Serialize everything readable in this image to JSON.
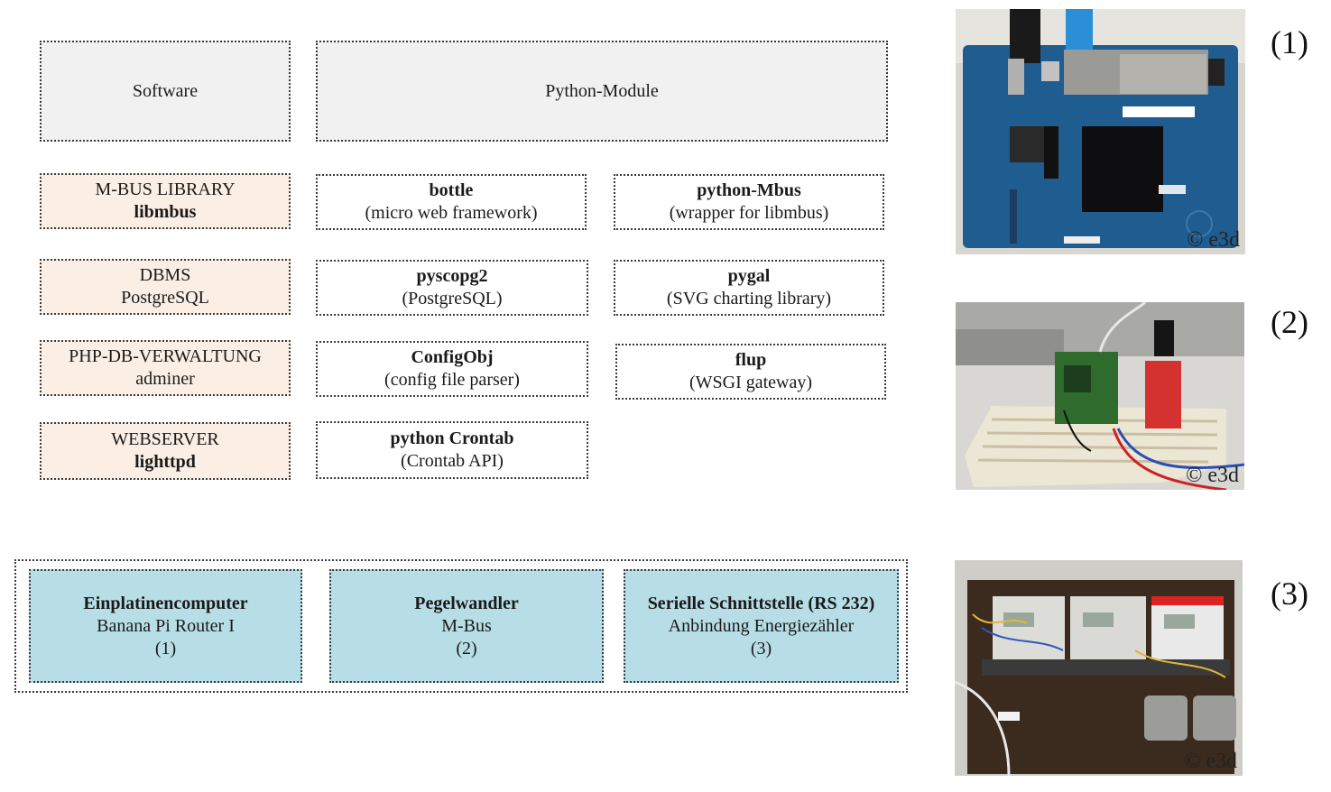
{
  "header": {
    "software": "Software",
    "python_modules": "Python-Module"
  },
  "software": [
    {
      "line1": "M-BUS LIBRARY",
      "line2": "libmbus"
    },
    {
      "line1": "DBMS",
      "line2": "PostgreSQL"
    },
    {
      "line1": "PHP-DB-VERWALTUNG",
      "line2": "adminer"
    },
    {
      "line1": "WEBSERVER",
      "line2": "lighttpd"
    }
  ],
  "modules": [
    {
      "name": "bottle",
      "desc": "(micro web framework)"
    },
    {
      "name": "python-Mbus",
      "desc": "(wrapper for libmbus)"
    },
    {
      "name": "pyscopg2",
      "desc": "(PostgreSQL)"
    },
    {
      "name": "pygal",
      "desc": "(SVG charting library)"
    },
    {
      "name": "ConfigObj",
      "desc": "(config file parser)"
    },
    {
      "name": "flup",
      "desc": "(WSGI gateway)"
    },
    {
      "name": "python Crontab",
      "desc": "(Crontab API)"
    }
  ],
  "hardware": [
    {
      "title": "Einplatinencomputer",
      "sub": "Banana Pi Router I",
      "ref": "(1)"
    },
    {
      "title": "Pegelwandler",
      "sub": "M-Bus",
      "ref": "(2)"
    },
    {
      "title": "Serielle Schnittstelle (RS 232)",
      "sub": "Anbindung Energiezähler",
      "ref": "(3)"
    }
  ],
  "photos": [
    {
      "copyright": "© e3d",
      "label": "(1)"
    },
    {
      "copyright": "© e3d",
      "label": "(2)"
    },
    {
      "copyright": "© e3d",
      "label": "(3)"
    }
  ],
  "colors": {
    "header_fill": "#f1f1f1",
    "software_fill": "#fbeee4",
    "hardware_fill": "#b7dde6",
    "board_blue": "#1f5c8f"
  }
}
